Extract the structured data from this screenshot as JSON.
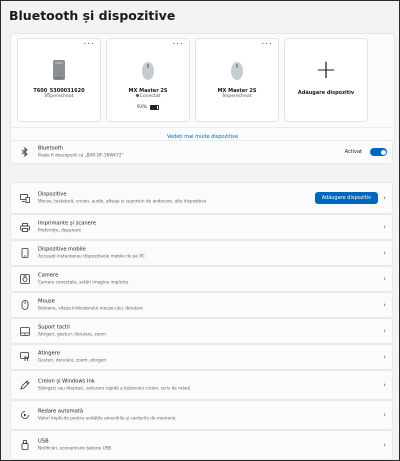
{
  "page": {
    "title": "Bluetooth și dispozitive"
  },
  "devices": [
    {
      "name": "T600_5300031620",
      "status": "Împerecheat",
      "battery": "",
      "icon": "computer-icon"
    },
    {
      "name": "MX Master 2S",
      "status": "Conectat",
      "battery": "93%",
      "icon": "mouse-icon"
    },
    {
      "name": "MX Master 2S",
      "status": "Împerecheat",
      "battery": "",
      "icon": "mouse-icon"
    }
  ],
  "add_device_card": {
    "label": "Adăugare dispozitiv"
  },
  "more_dots": "...",
  "see_more": "Vedeți mai multe dispozitive",
  "bluetooth": {
    "title": "Bluetooth",
    "subtitle": "Poate fi descoperit ca „BAR-OF-36WK72”",
    "status": "Activat",
    "enabled": true
  },
  "sections": [
    {
      "id": "dispozitive",
      "title": "Dispozitive",
      "subtitle": "Mouse, tastatură, creion, audio, afișaje și suporturi de andocare, alte dispozitive",
      "icon": "devices-icon",
      "button": "Adăugare dispozitiv"
    },
    {
      "id": "imprimante",
      "title": "Imprimante și scanere",
      "subtitle": "Preferințe, depanare",
      "icon": "printer-icon"
    },
    {
      "id": "mobile",
      "title": "Dispozitive mobile",
      "subtitle": "Accesați instantaneu dispozitivele mobile de pe PC",
      "icon": "phone-icon"
    },
    {
      "id": "camere",
      "title": "Camere",
      "subtitle": "Camere conectate, setări imagine implicite",
      "icon": "camera-icon"
    },
    {
      "id": "mouse",
      "title": "Mouse",
      "subtitle": "Butoane, viteza indicatorului mouse-ului, derulare",
      "icon": "mouse-icon"
    },
    {
      "id": "touchpad",
      "title": "Suport tactil",
      "subtitle": "Atingeri, gesturi, derulare, zoom",
      "icon": "touchpad-icon"
    },
    {
      "id": "atingere",
      "title": "Atingere",
      "subtitle": "Gesturi, derulare, zoom, atingeri",
      "icon": "touch-icon"
    },
    {
      "id": "creion",
      "title": "Creion și Windows Ink",
      "subtitle": "Stângaci sau dreptaci, anturare rapidă a butonului creion, scris de mână",
      "icon": "pen-icon"
    },
    {
      "id": "autoplay",
      "title": "Redare automată",
      "subtitle": "Valori implicite pentru unitățile amovibile și cardurile de memorie",
      "icon": "autoplay-icon"
    },
    {
      "id": "usb",
      "title": "USB",
      "subtitle": "Notificări, economisire baterie USB",
      "icon": "usb-icon"
    }
  ],
  "colors": {
    "accent": "#0067c0",
    "background": "#f3f3f3",
    "card": "#fbfbfb",
    "connected": "#107c10"
  }
}
